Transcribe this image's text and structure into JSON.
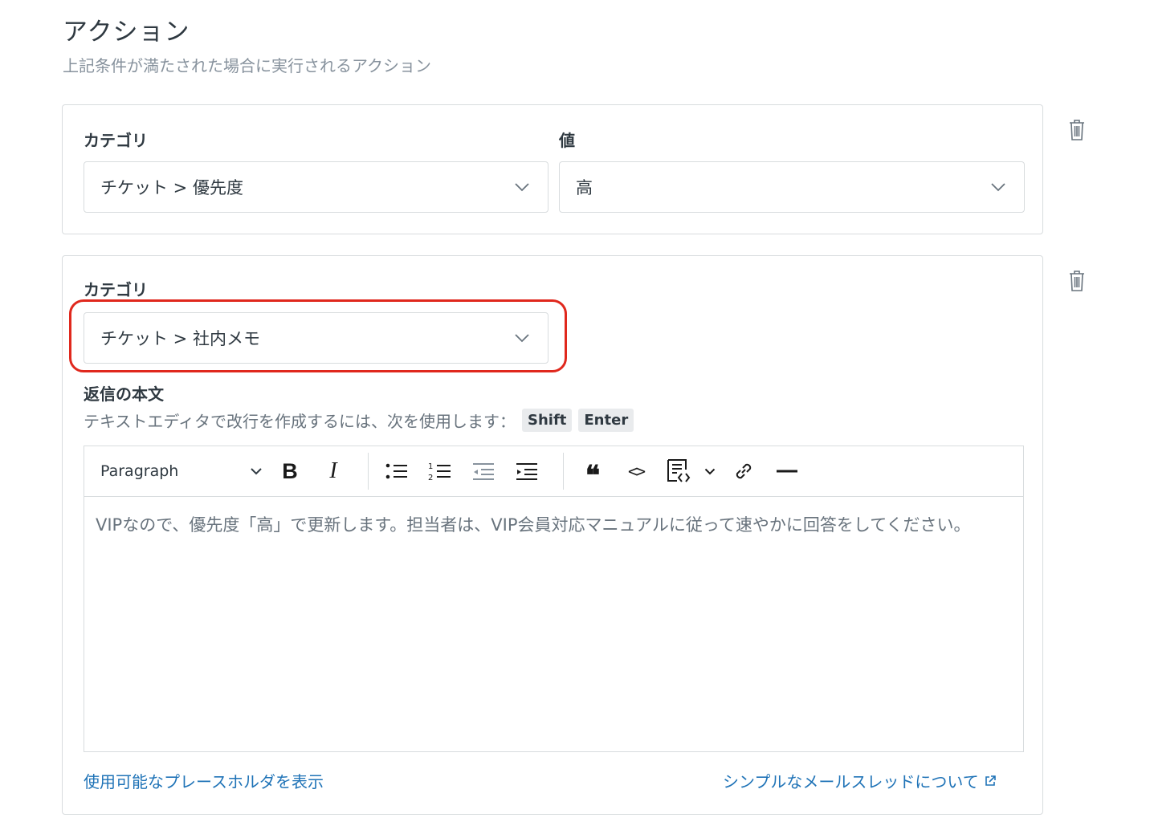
{
  "section": {
    "title": "アクション",
    "subtitle": "上記条件が満たされた場合に実行されるアクション"
  },
  "action1": {
    "category_label": "カテゴリ",
    "category_value": "チケット > 優先度",
    "value_label": "値",
    "value_value": "高"
  },
  "action2": {
    "category_label": "カテゴリ",
    "category_value": "チケット > 社内メモ",
    "body_label": "返信の本文",
    "hint_text": "テキストエディタで改行を作成するには、次を使用します：",
    "key1": "Shift",
    "key2": "Enter",
    "editor": {
      "paragraph_style": "Paragraph",
      "bold_glyph": "B",
      "italic_glyph": "I",
      "quote_glyph": "❝",
      "code_glyph": "<>",
      "content": "VIPなので、優先度「高」で更新します。担当者は、VIP会員対応マニュアルに従って速やかに回答をしてください。"
    },
    "placeholder_link": "使用可能なプレースホルダを表示",
    "thread_link": "シンプルなメールスレッドについて"
  },
  "colors": {
    "highlight": "#e0281d",
    "link": "#1f73b7",
    "border": "#d8dcde"
  },
  "icons": [
    "trash-icon",
    "chevron-down-icon",
    "bold-icon",
    "italic-icon",
    "bulleted-list-icon",
    "numbered-list-icon",
    "outdent-icon",
    "indent-icon",
    "quote-icon",
    "code-icon",
    "code-block-icon",
    "link-icon",
    "horizontal-rule-icon",
    "external-link-icon"
  ]
}
